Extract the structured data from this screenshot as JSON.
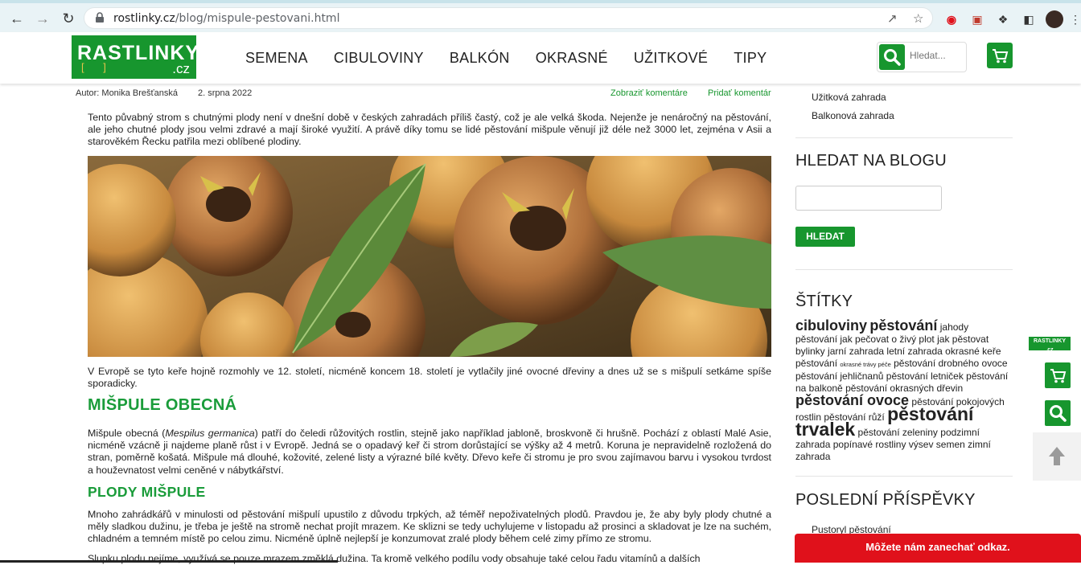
{
  "browser": {
    "url_host": "rostlinky.cz",
    "url_path": "/blog/mispule-pestovani.html"
  },
  "site": {
    "logo_text": "RASTLINKY",
    "logo_domain": ".cz",
    "logo_brackets": "[  ]",
    "menu": [
      "SEMENA",
      "CIBULOVINY",
      "BALKÓN",
      "OKRASNÉ",
      "UŽITKOVÉ",
      "TIPY"
    ],
    "search_placeholder": "Hledat..."
  },
  "article": {
    "author": "Autor: Monika Brešťanská",
    "date": "2. srpna 2022",
    "show_comments": "Zobraziť komentáre",
    "add_comment": "Pridať komentár",
    "intro": "Tento půvabný strom s chutnými plody není v dnešní době v českých zahradách příliš častý, což je ale velká škoda. Nejenže je nenáročný na pěstování, ale jeho chutné plody jsou velmi zdravé a mají široké využití. A právě díky tomu se lidé pěstování mišpule věnují již déle než 3000 let, zejména v Asii a starověkém Řecku patřila mezi oblíbené plodiny.",
    "para2": "V Evropě se tyto keře hojně rozmohly ve 12. století, nicméně koncem 18. století je vytlačily jiné ovocné dřeviny a dnes už se s mišpulí setkáme spíše sporadicky.",
    "h_obecna": "MIŠPULE OBECNÁ",
    "para3_a": "Mišpule obecná (",
    "para3_latin": "Mespilus germanica",
    "para3_b": ") patří do čeledi růžovitých rostlin, stejně jako například jabloně, broskvoně či hrušně. Pochází z oblastí Malé Asie, nicméně vzácně ji najdeme planě růst i v Evropě. Jedná se o opadavý keř či strom dorůstající se výšky až 4 metrů. Koruna je nepravidelně rozložená do stran, poměrně košatá. Mišpule má dlouhé, kožovité, zelené listy a výrazné bílé květy. Dřevo keře či stromu je pro svou zajímavou barvu i vysokou tvrdost a houževnatost velmi ceněné v nábytkářství.",
    "h_plody": "PLODY MIŠPULE",
    "para4": "Mnoho zahrádkářů v minulosti od pěstování mišpulí upustilo z důvodu trpkých, až téměř nepoživatelných plodů. Pravdou je, že aby byly plody chutné a měly sladkou dužinu, je třeba je ještě na stromě nechat projít mrazem. Ke sklizni se tedy uchylujeme v listopadu až prosinci a skladovat je lze na suchém, chladném a temném místě po celou zimu. Nicméně úplně nejlepší je konzumovat zralé plody během celé zimy přímo ze stromu.",
    "para5": "Slupku plodu nejíme, využívá se pouze mrazem změklá dužina. Ta kromě velkého podílu vody obsahuje také celou řadu vitamínů a dalších"
  },
  "sidebar": {
    "links": [
      "Užitková zahrada",
      "Balkonová zahrada"
    ],
    "search_heading": "HLEDAT NA BLOGU",
    "search_button": "HLEDAT",
    "tags_heading": "ŠTÍTKY",
    "recent_heading": "POSLEDNÍ PŘÍSPĚVKY",
    "recent_first": "Pustoryl pěstování"
  },
  "tags": {
    "t1": "cibuloviny",
    "t2": "pěstování",
    "t3": "jahody",
    "t4": "pěstování jak pečovat o živý plot",
    "t5": "jak pěstovat",
    "t6": "bylinky",
    "t7": "jarní zahrada",
    "t8": "letní zahrada",
    "t9": "okrasné keře",
    "t10": "pěstování",
    "t11": "okrasné trávy péče",
    "t12": "pěstování drobného ovoce",
    "t13": "pěstování jehličnanů",
    "t14": "pěstování letniček",
    "t15": "pěstování na balkoně",
    "t16": "pěstování okrasných dřevin",
    "t17": "pěstování ovoce",
    "t18": "pěstování pokojových rostlin",
    "t19": "pěstování růží",
    "t20": "pěstování trvalek",
    "t21": "pěstování zeleniny",
    "t22": "podzimní zahrada",
    "t23": "popínavé rostliny",
    "t24": "výsev semen",
    "t25": "zimní zahrada"
  },
  "float": {
    "logo": "RASTLINKY",
    "logo_domain": ".cz",
    "leave_link": "Môžete nám zanechať odkaz."
  },
  "colors": {
    "brand_green": "#17962e",
    "heading_green": "#1a9c3a",
    "alert_red": "#e0111b"
  }
}
